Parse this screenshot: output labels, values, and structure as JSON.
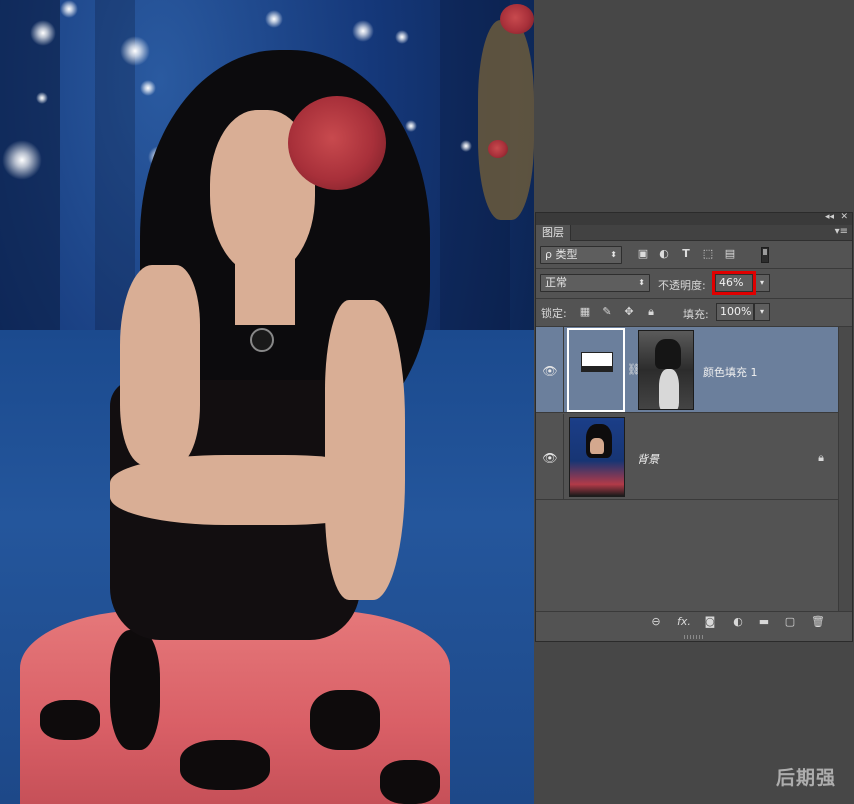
{
  "panel": {
    "tab_label": "图层",
    "collapse_icon": "double-chevron-left-icon",
    "menu_icon": "panel-menu-icon"
  },
  "filter": {
    "kind_label": "ρ 类型",
    "icons": [
      "image-filter-icon",
      "adjustment-filter-icon",
      "type-filter-icon",
      "shape-filter-icon",
      "smart-object-filter-icon"
    ]
  },
  "blend": {
    "mode_value": "正常",
    "opacity_label": "不透明度:",
    "opacity_value": "46%",
    "highlight_color": "#e00000"
  },
  "lock_row": {
    "lock_label": "锁定:",
    "fill_label": "填充:",
    "fill_value": "100%"
  },
  "layers": [
    {
      "name": "颜色填充 1",
      "selected": true,
      "visible": true,
      "type": "fill",
      "italic": false
    },
    {
      "name": "背景",
      "selected": false,
      "visible": true,
      "type": "background",
      "italic": true,
      "locked": true
    }
  ],
  "selection_color": "#6b7f9c",
  "bottom_tools": [
    "link-layers-icon",
    "fx-icon",
    "add-mask-icon",
    "new-adjustment-icon",
    "new-group-icon",
    "new-layer-icon",
    "trash-icon"
  ],
  "bottom_fx_label": "fx.",
  "watermark": "后期强"
}
